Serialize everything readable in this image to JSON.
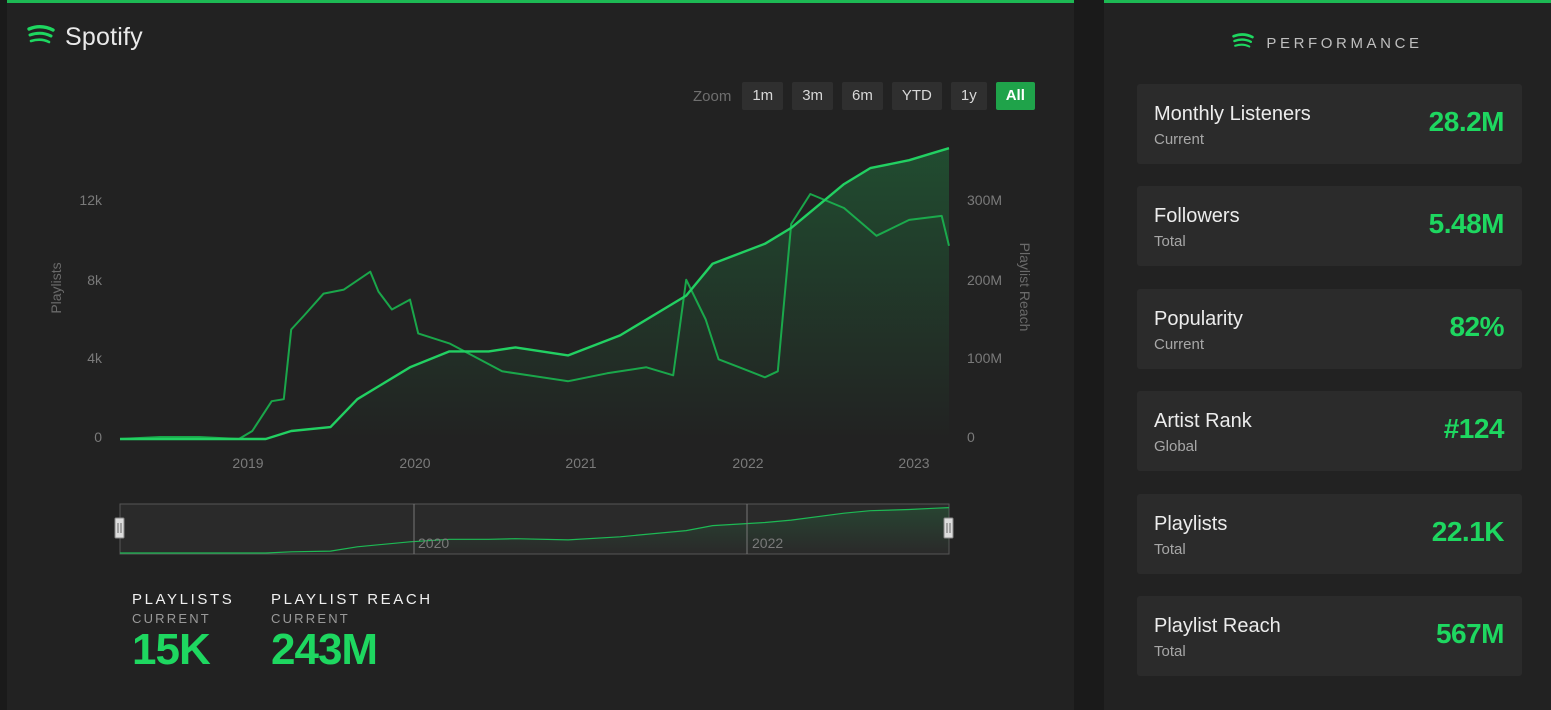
{
  "left_panel": {
    "brand_name": "Spotify",
    "zoom": {
      "label": "Zoom",
      "buttons": [
        "1m",
        "3m",
        "6m",
        "YTD",
        "1y",
        "All"
      ],
      "active": "All"
    },
    "stats": [
      {
        "title": "PLAYLISTS",
        "sub": "CURRENT",
        "value": "15K"
      },
      {
        "title": "PLAYLIST REACH",
        "sub": "CURRENT",
        "value": "243M"
      }
    ]
  },
  "chart_data": {
    "type": "line",
    "y_left": {
      "label": "Playlists",
      "ticks": [
        "0",
        "4k",
        "8k",
        "12k"
      ],
      "range": [
        0,
        12000
      ]
    },
    "y_right": {
      "label": "Playlist Reach",
      "ticks": [
        "0",
        "100M",
        "200M",
        "300M"
      ],
      "range": [
        0,
        300000000
      ]
    },
    "x_ticks": [
      "2019",
      "2020",
      "2021",
      "2022",
      "2023"
    ],
    "navigator_ticks": [
      "2020",
      "2022"
    ],
    "series": [
      {
        "axis": "left",
        "points": [
          [
            "2018-03-01",
            0
          ],
          [
            "2018-06-01",
            100
          ],
          [
            "2018-09-01",
            100
          ],
          [
            "2018-12-01",
            0
          ],
          [
            "2019-01-01",
            400
          ],
          [
            "2019-02-15",
            1900
          ],
          [
            "2019-03-15",
            2000
          ],
          [
            "2019-04-01",
            5500
          ],
          [
            "2019-05-01",
            6200
          ],
          [
            "2019-06-15",
            7300
          ],
          [
            "2019-08-01",
            7500
          ],
          [
            "2019-10-01",
            8400
          ],
          [
            "2019-10-20",
            7400
          ],
          [
            "2019-11-20",
            6500
          ],
          [
            "2020-01-01",
            7000
          ],
          [
            "2020-01-20",
            5300
          ],
          [
            "2020-04-01",
            4800
          ],
          [
            "2020-06-01",
            4100
          ],
          [
            "2020-08-01",
            3400
          ],
          [
            "2020-10-01",
            3200
          ],
          [
            "2021-01-01",
            2900
          ],
          [
            "2021-04-01",
            3300
          ],
          [
            "2021-07-01",
            3600
          ],
          [
            "2021-09-01",
            3200
          ],
          [
            "2021-10-01",
            8000
          ],
          [
            "2021-11-15",
            6000
          ],
          [
            "2021-12-15",
            4000
          ],
          [
            "2022-02-01",
            3600
          ],
          [
            "2022-04-01",
            3100
          ],
          [
            "2022-05-01",
            3400
          ],
          [
            "2022-06-01",
            10800
          ],
          [
            "2022-07-15",
            12300
          ],
          [
            "2022-10-01",
            11600
          ],
          [
            "2022-12-15",
            10200
          ],
          [
            "2023-03-01",
            11000
          ],
          [
            "2023-05-15",
            11200
          ],
          [
            "2023-06-01",
            9700
          ]
        ]
      },
      {
        "axis": "right",
        "points": [
          [
            "2018-03-01",
            0
          ],
          [
            "2018-10-01",
            0
          ],
          [
            "2019-02-01",
            0
          ],
          [
            "2019-04-01",
            10000000
          ],
          [
            "2019-07-01",
            15000000
          ],
          [
            "2019-09-01",
            50000000
          ],
          [
            "2020-01-01",
            90000000
          ],
          [
            "2020-04-01",
            110000000
          ],
          [
            "2020-07-01",
            110000000
          ],
          [
            "2020-09-01",
            115000000
          ],
          [
            "2021-01-01",
            105000000
          ],
          [
            "2021-05-01",
            130000000
          ],
          [
            "2021-10-01",
            180000000
          ],
          [
            "2021-12-01",
            220000000
          ],
          [
            "2022-04-01",
            245000000
          ],
          [
            "2022-06-01",
            265000000
          ],
          [
            "2022-10-01",
            320000000
          ],
          [
            "2022-12-01",
            340000000
          ],
          [
            "2023-03-01",
            350000000
          ],
          [
            "2023-05-01",
            360000000
          ],
          [
            "2023-06-01",
            365000000
          ]
        ]
      }
    ]
  },
  "performance": {
    "title": "PERFORMANCE",
    "cards": [
      {
        "label": "Monthly Listeners",
        "sub": "Current",
        "value": "28.2M"
      },
      {
        "label": "Followers",
        "sub": "Total",
        "value": "5.48M"
      },
      {
        "label": "Popularity",
        "sub": "Current",
        "value": "82%"
      },
      {
        "label": "Artist Rank",
        "sub": "Global",
        "value": "#124"
      },
      {
        "label": "Playlists",
        "sub": "Total",
        "value": "22.1K"
      },
      {
        "label": "Playlist Reach",
        "sub": "Total",
        "value": "567M"
      }
    ]
  },
  "colors": {
    "accent": "#1ed760",
    "line": "#1db954",
    "panel": "#222222",
    "card": "#2b2b2b"
  }
}
